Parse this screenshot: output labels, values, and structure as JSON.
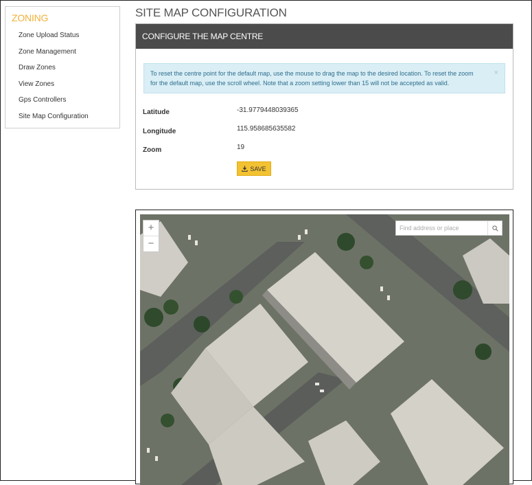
{
  "sidebar": {
    "title": "ZONING",
    "items": [
      {
        "label": "Zone Upload Status"
      },
      {
        "label": "Zone Management"
      },
      {
        "label": "Draw Zones"
      },
      {
        "label": "View Zones"
      },
      {
        "label": "Gps Controllers"
      },
      {
        "label": "Site Map Configuration"
      }
    ]
  },
  "page": {
    "title": "SITE MAP CONFIGURATION"
  },
  "panel": {
    "header": "CONFIGURE THE MAP CENTRE",
    "alert_text": "To reset the centre point for the default map, use the mouse to drag the map to the desired location. To reset the zoom for the default map, use the scroll wheel. Note that a zoom setting lower than 15 will not be accepted as valid.",
    "alert_close": "×",
    "fields": {
      "latitude": {
        "label": "Latitude",
        "value": "-31.9779448039365"
      },
      "longitude": {
        "label": "Longitude",
        "value": "115.958685635582"
      },
      "zoom": {
        "label": "Zoom",
        "value": "19"
      }
    },
    "save_label": "SAVE"
  },
  "map": {
    "zoom_in": "+",
    "zoom_out": "−",
    "search_placeholder": "Find address or place"
  },
  "icons": {
    "save": "download-icon",
    "search": "search-icon",
    "close": "close-icon"
  },
  "colors": {
    "accent": "#f0b13a",
    "header_bg": "#4b4b4b",
    "alert_bg": "#daeef6",
    "button_bg": "#f3c232"
  }
}
